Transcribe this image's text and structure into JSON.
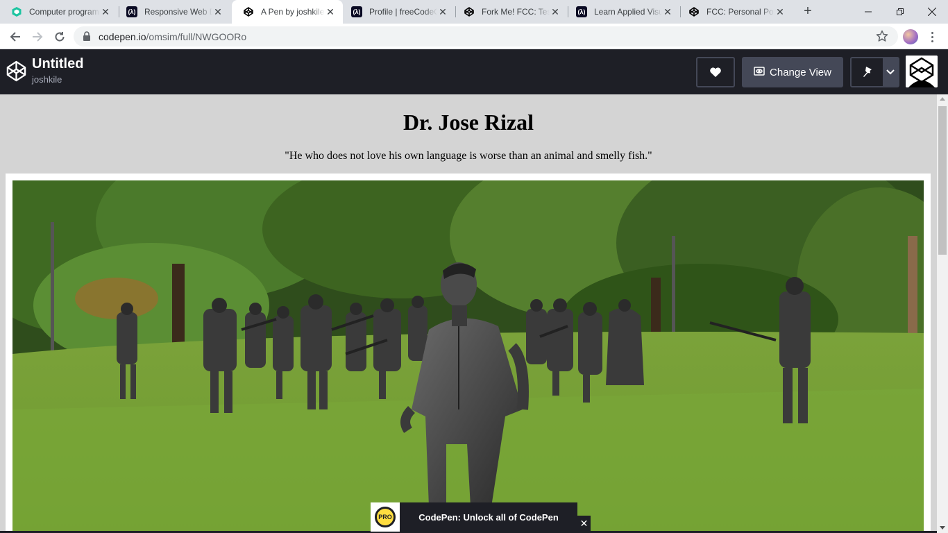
{
  "browser": {
    "tabs": [
      {
        "title": "Computer programming",
        "icon": "codeacademy-icon"
      },
      {
        "title": "Responsive Web Design",
        "icon": "freecodecamp-icon"
      },
      {
        "title": "A Pen by joshkile",
        "icon": "codepen-icon",
        "active": true
      },
      {
        "title": "Profile | freeCodeCamp",
        "icon": "freecodecamp-icon"
      },
      {
        "title": "Fork Me! FCC: Test",
        "icon": "codepen-icon"
      },
      {
        "title": "Learn Applied Visual",
        "icon": "freecodecamp-icon"
      },
      {
        "title": "FCC: Personal Portfolio",
        "icon": "codepen-icon"
      }
    ],
    "url_host": "codepen.io",
    "url_path": "/omsim/full/NWGOORo"
  },
  "codepen": {
    "title": "Untitled",
    "user": "joshkile",
    "change_view_label": "Change View"
  },
  "page": {
    "heading": "Dr. Jose Rizal",
    "quote": "\"He who does not love his own language is worse than an animal and smelly fish.\""
  },
  "promo": {
    "badge": "PRO",
    "text": "CodePen: Unlock all of CodePen",
    "close": "✕"
  },
  "colors": {
    "codepen_header": "#1e1f26",
    "codepen_button": "#444857",
    "page_background": "#d4d4d4",
    "pro_yellow": "#ffdd40"
  }
}
